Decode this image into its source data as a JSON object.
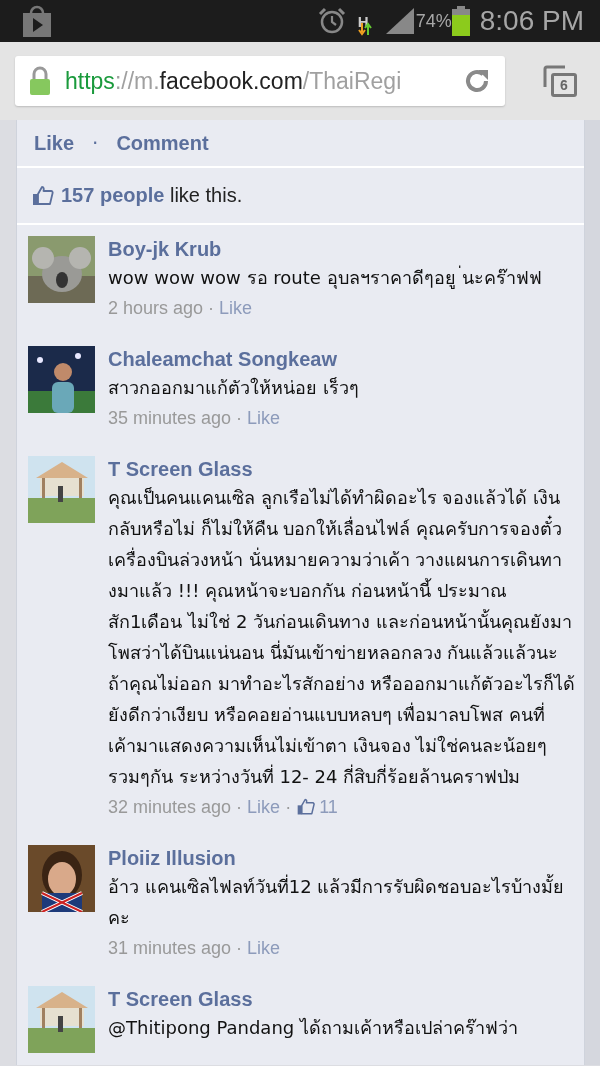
{
  "status_bar": {
    "battery_percent": "74%",
    "time": "8:06 PM",
    "network": "H"
  },
  "address_bar": {
    "url": {
      "scheme": "https",
      "separator": "://",
      "subdomain": "m.",
      "domain": "facebook.com",
      "path": "/ThaiRegi"
    },
    "tab_count": "6"
  },
  "post_actions": [
    {
      "label": "Like"
    },
    {
      "label": "Comment"
    }
  ],
  "post_actions_separator": "·",
  "meta_separator": "·",
  "likes_summary": {
    "count": "157 people",
    "text": "like this."
  },
  "comments": [
    {
      "author": "Boy-jk Krub",
      "lines": [
        "wow wow wow รอ route อุบลฯราคาดีๆอยู   ่นะคร๊าฟฟ"
      ],
      "time": "2 hours ago",
      "like": "Like"
    },
    {
      "author": "Chaleamchat Songkeaw",
      "lines": [
        "สาวกออกมาแก้ตัวให้หน่อย เร็วๆ"
      ],
      "time": "35 minutes ago",
      "like": "Like"
    },
    {
      "author": "T Screen Glass",
      "lines": [
        "คุณเป็นคนแคนเซิล ลูกเรือไม่ได้ทำผิดอะไร จองแล้วได้ เงิน",
        "กลับหรือไม่ ก็ไม่ให้คืน บอกให้เลื่อนไฟล์ คุณครับการจองตั๋ว",
        "เครื่องบินล่วงหน้า นั่นหมายความว่าเค้า วางแผนการเดินทา",
        "งมาแล้ว !!! คุณหน้าจะบอกกัน  ก่อนหน้านี้ ประมาณ",
        "สัก1เดือน ไม่ใช่ 2 วันก่อนเดินทาง และก่อนหน้านั้นคุณยังมา",
        "โพสว่าได้บินแน่นอน นี่มันเข้าข่ายหลอกลวง กันแล้วแล้วนะ",
        "ถ้าคุณไม่ออก มาทำอะไรสักอย่าง หรือออกมาแก้ตัวอะไรก็ได้",
        "ยังดีกว่าเงียบ หรือคอยอ่านแบบหลบๆ เพื่อมาลบโพส คนที่",
        "เค้ามาแสดงความเห็นไม่เข้าตา เงินจอง ไม่ใช่คนละน้อยๆ",
        "รวมๆกัน ระหว่างวันที่ 12- 24 กี่สิบกี่ร้อยล้านคราฟป่ม"
      ],
      "time": "32 minutes ago",
      "like": "Like",
      "likes": "11"
    },
    {
      "author": "Ploiiz Illusion",
      "lines": [
        "อ้าว แคนเซิลไฟลท์วันที่12 แล้วมีการรับผิดชอบอะไรบ้างมั้ย",
        "คะ"
      ],
      "time": "31 minutes ago",
      "like": "Like"
    },
    {
      "author": "T Screen Glass",
      "lines": [
        "@Thitipong Pandang ได้ถามเค้าหรือเปล่าคร๊าฟว่า"
      ]
    }
  ]
}
